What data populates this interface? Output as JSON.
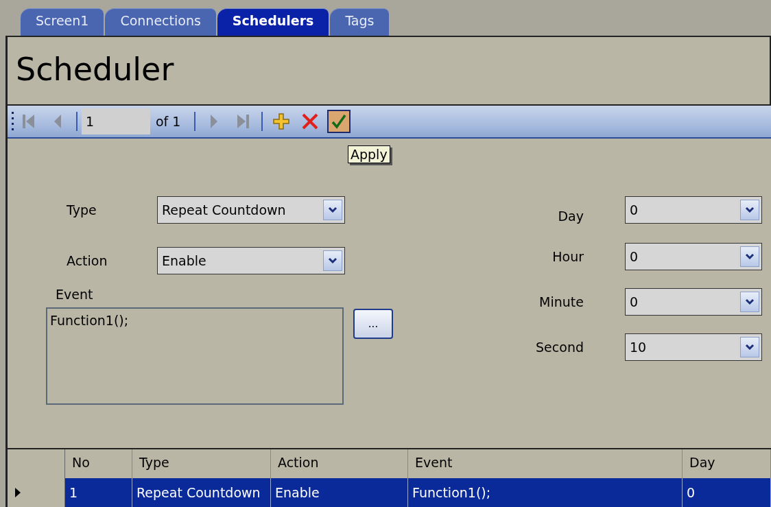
{
  "tabs": [
    {
      "label": "Screen1",
      "selected": false
    },
    {
      "label": "Connections",
      "selected": false
    },
    {
      "label": "Schedulers",
      "selected": true
    },
    {
      "label": "Tags",
      "selected": false
    }
  ],
  "header": {
    "title": "Scheduler"
  },
  "toolbar": {
    "page": "1",
    "page_count": "of 1",
    "tooltip": "Apply"
  },
  "form": {
    "left": [
      {
        "label": "Type",
        "value": "Repeat Countdown"
      },
      {
        "label": "Action",
        "value": "Enable"
      }
    ],
    "event": {
      "label": "Event",
      "value": "Function1();",
      "browse": "..."
    },
    "timing": [
      {
        "label": "Day",
        "value": "0"
      },
      {
        "label": "Hour",
        "value": "0"
      },
      {
        "label": "Minute",
        "value": "0"
      },
      {
        "label": "Second",
        "value": "10"
      }
    ]
  },
  "grid": {
    "columns": [
      "No",
      "Type",
      "Action",
      "Event",
      "Day"
    ],
    "rows": [
      {
        "selected": true,
        "cells": [
          "1",
          "Repeat Countdown",
          "Enable",
          "Function1();",
          "0"
        ]
      }
    ]
  }
}
